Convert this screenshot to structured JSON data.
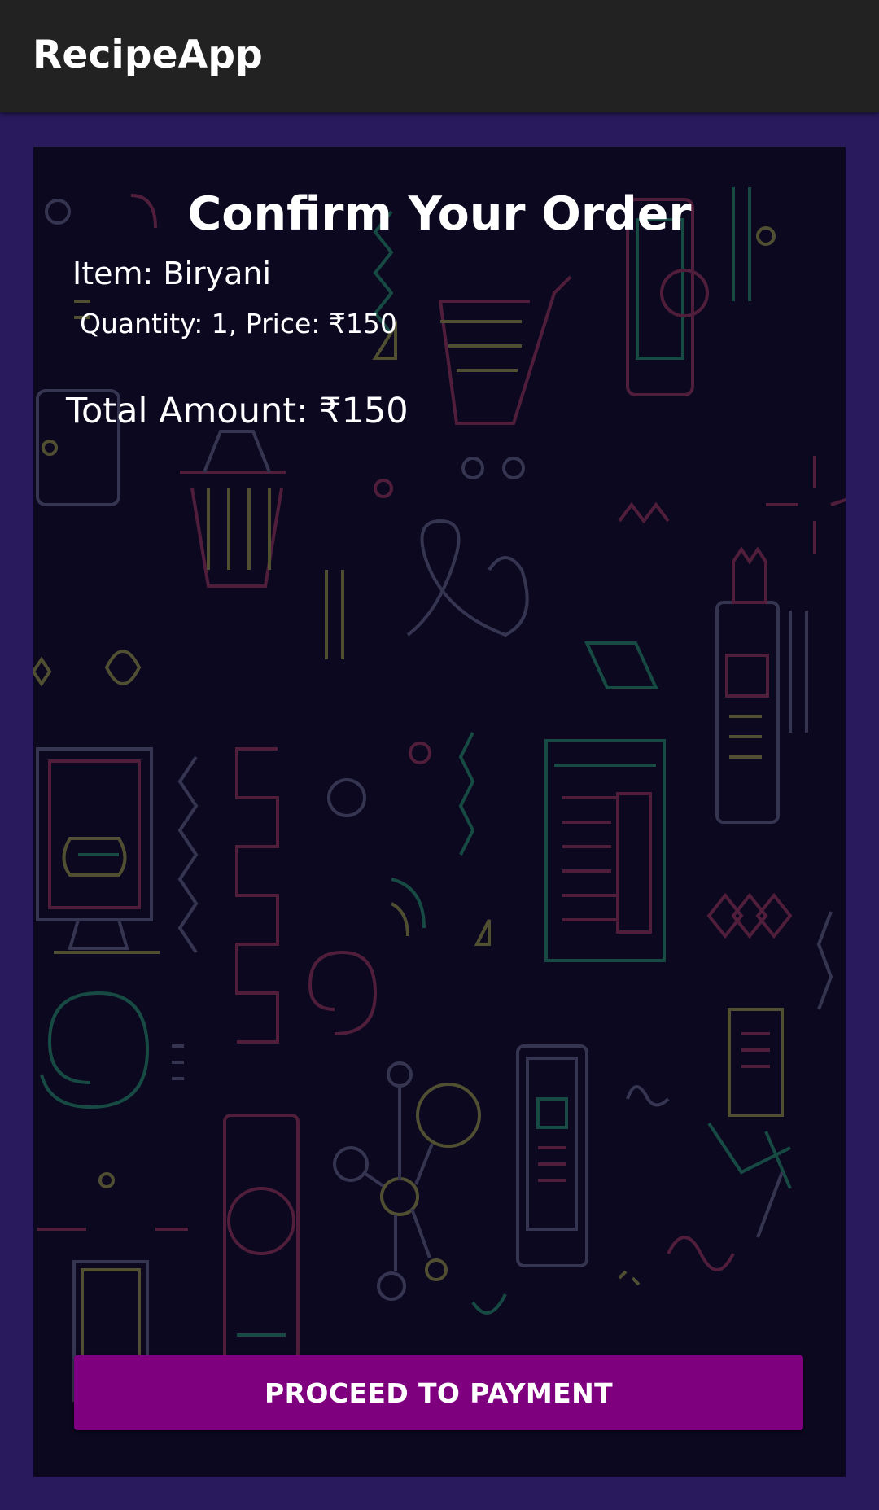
{
  "app": {
    "title": "RecipeApp"
  },
  "order": {
    "heading": "Confirm Your Order",
    "item_line": "Item: Biryani",
    "qty_price_line": "Quantity: 1, Price: ₹150",
    "total_line": "Total Amount: ₹150",
    "item": "Biryani",
    "quantity": 1,
    "price": 150,
    "total": 150,
    "currency": "₹"
  },
  "actions": {
    "pay_label": "PROCEED TO PAYMENT"
  },
  "colors": {
    "app_bar": "#222222",
    "page_background": "#281a5c",
    "card_background": "#0b0820",
    "button": "#7f007f",
    "text": "#ffffff"
  }
}
